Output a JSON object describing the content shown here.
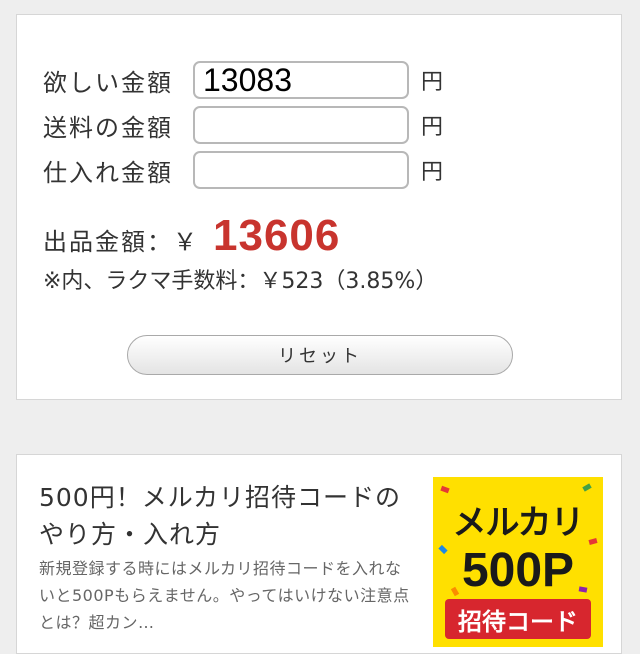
{
  "calculator": {
    "rows": [
      {
        "label": "欲しい金額",
        "value": "13083",
        "unit": "円"
      },
      {
        "label": "送料の金額",
        "value": "",
        "unit": "円"
      },
      {
        "label": "仕入れ金額",
        "value": "",
        "unit": "円"
      }
    ],
    "result_label": "出品金額：￥",
    "result_value": "13606",
    "fee_text": "※内、ラクマ手数料：￥523（3.85%）",
    "reset_label": "リセット"
  },
  "article": {
    "title": "500円！メルカリ招待コードのやり方・入れ方",
    "excerpt": "新規登録する時にはメルカリ招待コードを入れないと500Pもらえません。やってはいけない注意点とは？超カン…",
    "thumbnail": {
      "line1": "メルカリ",
      "line2": "500P",
      "banner": "招待コード"
    }
  },
  "colors": {
    "result_value": "#c8342e",
    "thumb_bg": "#ffe000",
    "thumb_banner": "#d7262e"
  }
}
